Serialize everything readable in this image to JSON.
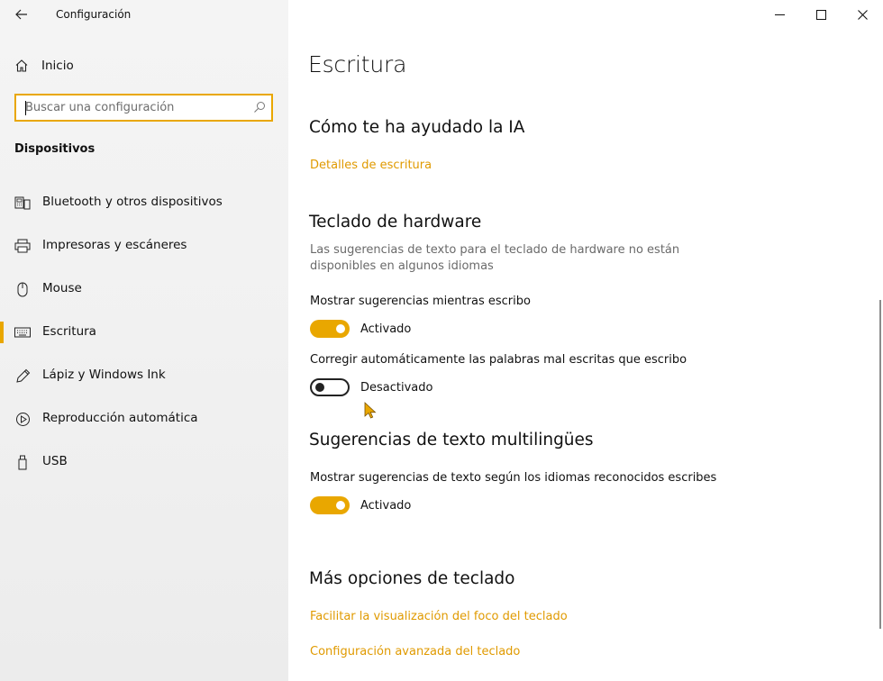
{
  "window": {
    "title": "Configuración"
  },
  "sidebar": {
    "home_label": "Inicio",
    "search_placeholder": "Buscar una configuración",
    "section_title": "Dispositivos",
    "items": [
      {
        "label": "Bluetooth y otros dispositivos",
        "icon": "bluetooth-devices-icon"
      },
      {
        "label": "Impresoras y escáneres",
        "icon": "printer-icon"
      },
      {
        "label": "Mouse",
        "icon": "mouse-icon"
      },
      {
        "label": "Escritura",
        "icon": "keyboard-icon",
        "active": true
      },
      {
        "label": "Lápiz y Windows Ink",
        "icon": "pen-icon"
      },
      {
        "label": "Reproducción automática",
        "icon": "autoplay-icon"
      },
      {
        "label": "USB",
        "icon": "usb-icon"
      }
    ]
  },
  "main": {
    "page_title": "Escritura",
    "ai_section": {
      "title": "Cómo te ha ayudado la IA",
      "link": "Detalles de escritura"
    },
    "hardware_section": {
      "title": "Teclado de hardware",
      "description": "Las sugerencias de texto para el teclado de hardware no están disponibles en algunos idiomas",
      "suggestions_label": "Mostrar sugerencias mientras escribo",
      "suggestions_state": "Activado",
      "autocorrect_label": "Corregir automáticamente las palabras mal escritas que escribo",
      "autocorrect_state": "Desactivado"
    },
    "multilingual_section": {
      "title": "Sugerencias de texto multilingües",
      "label": "Mostrar sugerencias de texto según los idiomas reconocidos escribes",
      "state": "Activado"
    },
    "more_section": {
      "title": "Más opciones de teclado",
      "link1": "Facilitar la visualización del foco del teclado",
      "link2": "Configuración avanzada del teclado"
    }
  },
  "colors": {
    "accent": "#e9a700",
    "link": "#e09a00",
    "sidebar_bg": "#f2f2f2"
  }
}
